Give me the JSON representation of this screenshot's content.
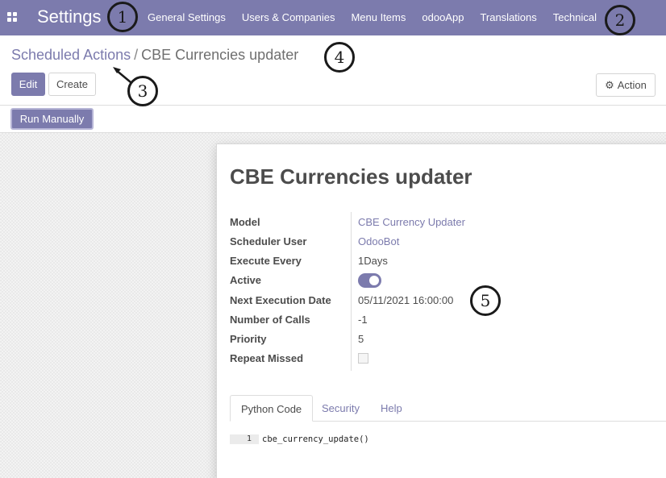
{
  "navbar": {
    "brand": "Settings",
    "menu": [
      "General Settings",
      "Users & Companies",
      "Menu Items",
      "odooApp",
      "Translations",
      "Technical"
    ]
  },
  "breadcrumb": {
    "parent": "Scheduled Actions",
    "separator": "/",
    "current": "CBE Currencies updater"
  },
  "buttons": {
    "edit": "Edit",
    "create": "Create",
    "action": "Action",
    "run_manually": "Run Manually"
  },
  "record": {
    "title": "CBE Currencies updater",
    "fields": [
      {
        "label": "Model",
        "value": "CBE Currency Updater"
      },
      {
        "label": "Scheduler User",
        "value": "OdooBot"
      },
      {
        "label": "Execute Every",
        "value": "1Days"
      },
      {
        "label": "Active",
        "value": true
      },
      {
        "label": "Next Execution Date",
        "value": "05/11/2021 16:00:00"
      },
      {
        "label": "Number of Calls",
        "value": "-1"
      },
      {
        "label": "Priority",
        "value": "5"
      },
      {
        "label": "Repeat Missed",
        "value": false
      }
    ]
  },
  "tabs": [
    "Python Code",
    "Security",
    "Help"
  ],
  "code": {
    "line_number": "1",
    "line": "cbe_currency_update()"
  },
  "callouts": [
    "1",
    "2",
    "3",
    "4",
    "5"
  ],
  "colors": {
    "brand": "#7c7bad",
    "text": "#4c4c4c"
  },
  "icons": [
    "apps-grid-icon",
    "gear-icon",
    "arrow-icon"
  ]
}
